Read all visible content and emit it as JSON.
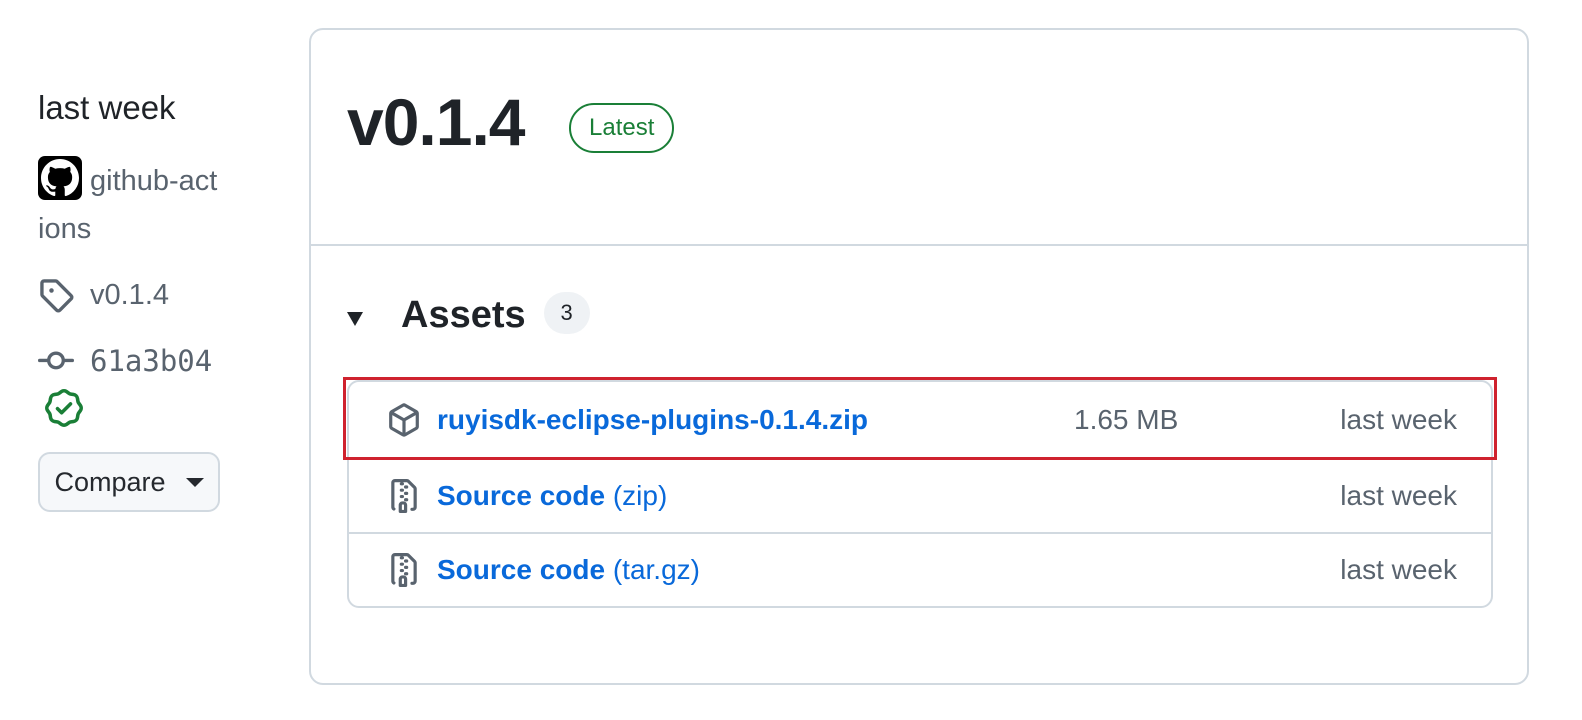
{
  "sidebar": {
    "date": "last week",
    "author": "github-actions",
    "tag": "v0.1.4",
    "commit": "61a3b04",
    "compare_label": "Compare",
    "icons": {
      "avatar": "github-mark-icon",
      "tag": "tag-icon",
      "commit": "git-commit-icon",
      "verified": "verified-check-icon",
      "compare": "triangle-down-icon"
    }
  },
  "release": {
    "title": "v0.1.4",
    "badge": "Latest",
    "badge_color": "#1a7f37"
  },
  "assets": {
    "label": "Assets",
    "count": "3",
    "items": [
      {
        "icon": "package-icon",
        "name": "ruyisdk-eclipse-plugins-0.1.4.zip",
        "suffix": "",
        "size": "1.65 MB",
        "date": "last week",
        "highlighted": true
      },
      {
        "icon": "file-zip-icon",
        "name": "Source code",
        "suffix": " (zip)",
        "size": "",
        "date": "last week",
        "highlighted": false
      },
      {
        "icon": "file-zip-icon",
        "name": "Source code",
        "suffix": " (tar.gz)",
        "size": "",
        "date": "last week",
        "highlighted": false
      }
    ]
  },
  "colors": {
    "link": "#0969da",
    "muted": "#59636e",
    "border": "#d1d9e0",
    "highlight": "#cf222e"
  }
}
